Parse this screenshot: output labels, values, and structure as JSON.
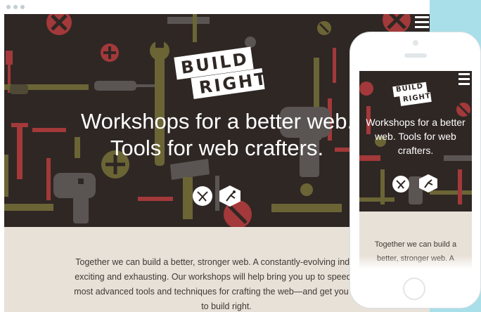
{
  "colors": {
    "backdrop": "#a8dfe8",
    "hero_bg": "#2f2724",
    "content_bg": "#e8e1d8",
    "tool_red": "#a3393a",
    "tool_olive": "#6b6536",
    "tool_gray": "#5a5553",
    "text_dark": "#403935"
  },
  "browser": {
    "window_controls": [
      "close-dot",
      "minimize-dot",
      "maximize-dot"
    ]
  },
  "site": {
    "logo": {
      "line1": "BUILD",
      "line2": "RIGHT"
    },
    "headline_line1": "Workshops for a better web.",
    "headline_line2": "Tools for web crafters.",
    "icons": [
      "workshop-tools-icon",
      "robot-arm-icon"
    ],
    "body_copy": "Together we can build a better, stronger web. A constantly-evolving industry is exciting and exhausting. Our workshops will help bring you up to speed on the most advanced tools and techniques for crafting the web—and get you excited to build right.",
    "menu_icon": "hamburger-menu-icon"
  },
  "phone": {
    "logo": {
      "line1": "BUILD",
      "line2": "RIGHT"
    },
    "headline": "Workshops for a better web. Tools for web crafters.",
    "body_copy": "Together we can build a better, stronger web. A constantly-evolving industry is exciting"
  }
}
